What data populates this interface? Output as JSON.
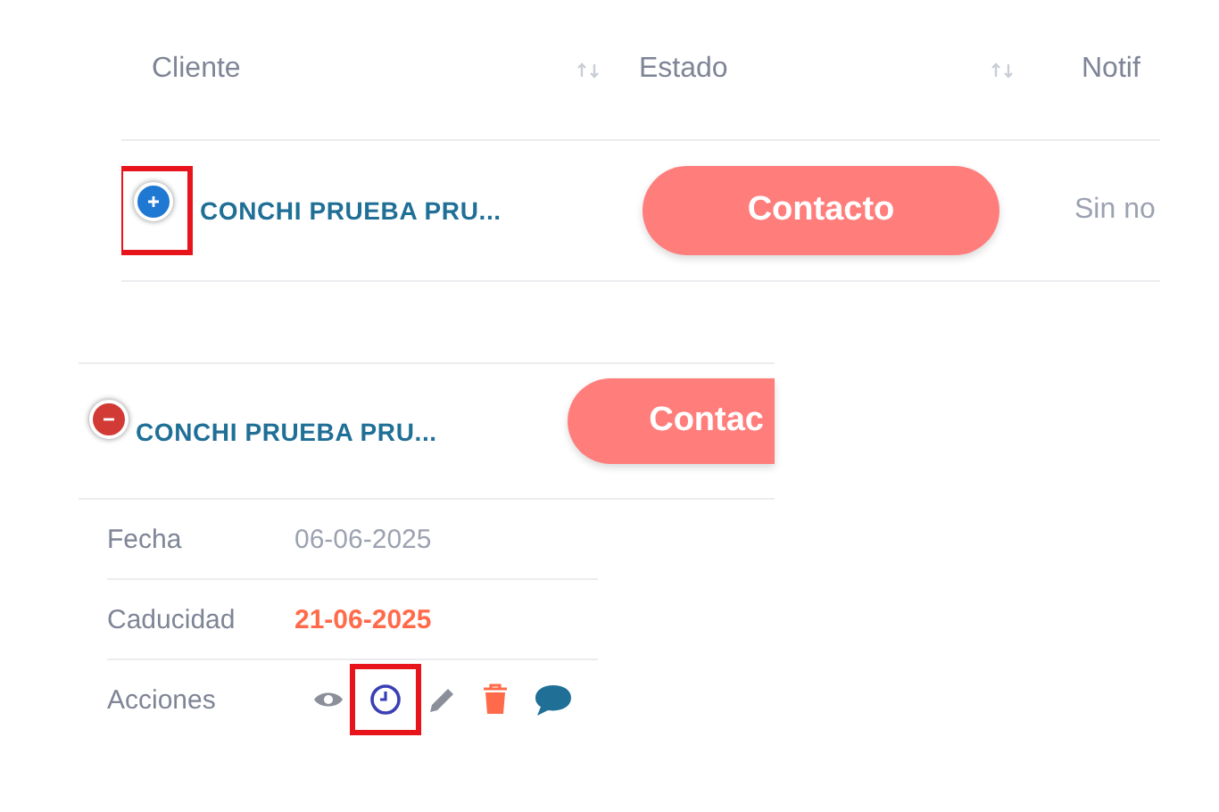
{
  "table": {
    "columns": [
      {
        "label": "Cliente",
        "sortable": true
      },
      {
        "label": "Estado",
        "sortable": true
      },
      {
        "label": "Notif",
        "sortable": false
      }
    ],
    "row": {
      "expanded": false,
      "highlighted": true,
      "client": "CONCHI PRUEBA PRU...",
      "status": "Contacto",
      "notification": "Sin no"
    }
  },
  "expanded_row": {
    "expanded": true,
    "client": "CONCHI PRUEBA PRU...",
    "status": "Contac",
    "details": [
      {
        "label": "Fecha",
        "value": "06-06-2025",
        "overdue": false
      },
      {
        "label": "Caducidad",
        "value": "21-06-2025",
        "overdue": true
      }
    ],
    "actions_label": "Acciones",
    "actions": [
      {
        "kind": "view",
        "highlighted": false
      },
      {
        "kind": "history",
        "highlighted": true
      },
      {
        "kind": "edit",
        "highlighted": false
      },
      {
        "kind": "delete",
        "highlighted": false
      },
      {
        "kind": "comment",
        "highlighted": false
      }
    ]
  }
}
